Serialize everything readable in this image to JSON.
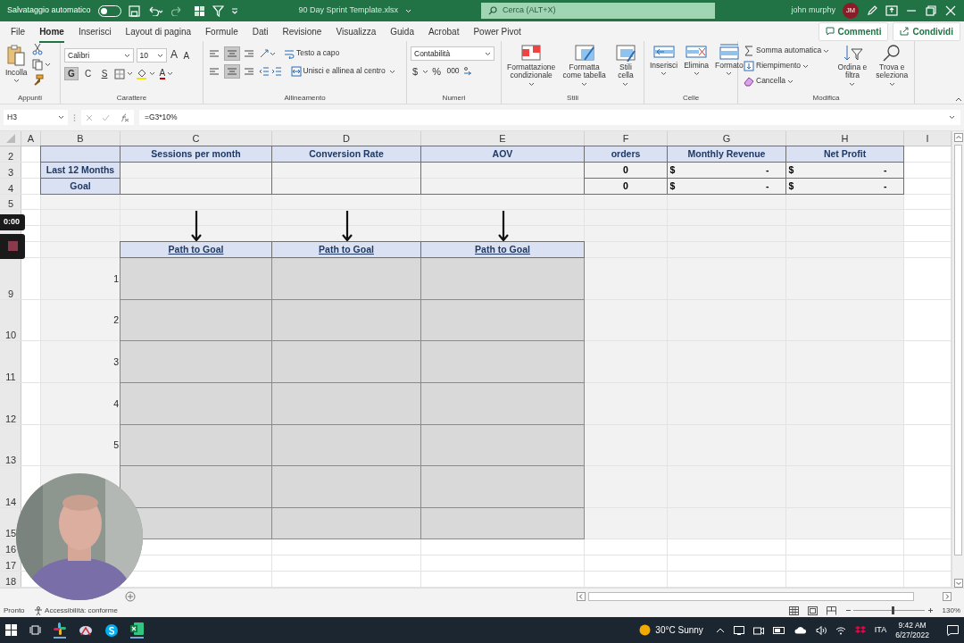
{
  "title_bar": {
    "autosave_label": "Salvataggio automatico",
    "autosave_on": false,
    "file_name": "90 Day Sprint Template.xlsx",
    "search_placeholder": "Cerca (ALT+X)",
    "user_name": "john murphy",
    "user_initials": "JM"
  },
  "tabs": [
    {
      "label": "File",
      "selected": false
    },
    {
      "label": "Home",
      "selected": true
    },
    {
      "label": "Inserisci",
      "selected": false
    },
    {
      "label": "Layout di pagina",
      "selected": false
    },
    {
      "label": "Formule",
      "selected": false
    },
    {
      "label": "Dati",
      "selected": false
    },
    {
      "label": "Revisione",
      "selected": false
    },
    {
      "label": "Visualizza",
      "selected": false
    },
    {
      "label": "Guida",
      "selected": false
    },
    {
      "label": "Acrobat",
      "selected": false
    },
    {
      "label": "Power Pivot",
      "selected": false
    }
  ],
  "comments_button": "Commenti",
  "share_button": "Condividi",
  "ribbon": {
    "clipboard": {
      "paste": "Incolla",
      "group": "Appunti"
    },
    "font": {
      "name": "Calibri",
      "size": "10",
      "grow": "A",
      "shrink": "A",
      "bold": {
        "label": "G",
        "on": true
      },
      "italic": {
        "label": "C",
        "on": false
      },
      "underline": {
        "label": "S",
        "on": false
      },
      "font_color": "A",
      "group": "Carattere"
    },
    "alignment": {
      "center_on": true,
      "wrap": "Testo a capo",
      "merge": "Unisci e allinea al centro",
      "group": "Allineamento"
    },
    "number": {
      "format": "Contabilità",
      "currency": "$",
      "percent": "%",
      "thousands": "000",
      "group": "Numeri"
    },
    "styles": {
      "items": [
        "Formattazione condizionale",
        "Formatta come tabella",
        "Stili cella"
      ],
      "group": "Stili"
    },
    "cells": {
      "items": [
        "Inserisci",
        "Elimina",
        "Formato"
      ],
      "group": "Celle"
    },
    "editing": {
      "items": [
        "Somma automatica",
        "Riempimento",
        "Cancella"
      ],
      "large": [
        "Ordina e filtra",
        "Trova e seleziona"
      ],
      "group": "Modifica"
    }
  },
  "formula_bar": {
    "name_box": "H3",
    "formula": "=G3*10%"
  },
  "sheet": {
    "columns": [
      "A",
      "B",
      "C",
      "D",
      "E",
      "F",
      "G",
      "H",
      "I"
    ],
    "row_numbers": [
      "2",
      "3",
      "4",
      "5",
      "9",
      "10",
      "11",
      "12",
      "13",
      "14",
      "15",
      "16",
      "17",
      "18"
    ],
    "summary": {
      "headers": [
        "Sessions per month",
        "Conversion Rate",
        "AOV",
        "orders",
        "Monthly Revenue",
        "Net Profit"
      ],
      "rows": [
        {
          "label": "Last 12 Months",
          "orders": "0",
          "revenue_currency": "$",
          "revenue": "-",
          "profit_currency": "$",
          "profit": "-"
        },
        {
          "label": "Goal",
          "orders": "0",
          "revenue_currency": "$",
          "revenue": "-",
          "profit_currency": "$",
          "profit": "-"
        }
      ]
    },
    "path": {
      "headers": [
        "Path to Goal",
        "Path to Goal",
        "Path to Goal"
      ],
      "steps": [
        "1",
        "2",
        "3",
        "4",
        "5"
      ]
    }
  },
  "recording": {
    "timer": "0:00"
  },
  "status_bar": {
    "ready": "Pronto",
    "accessibility": "Accessibilità: conforme",
    "zoom": "130%",
    "zoom_slider": {
      "level": 0.56
    }
  },
  "taskbar": {
    "weather": "30°C Sunny",
    "language": "ITA",
    "time": "9:42 AM",
    "date": "6/27/2022"
  }
}
